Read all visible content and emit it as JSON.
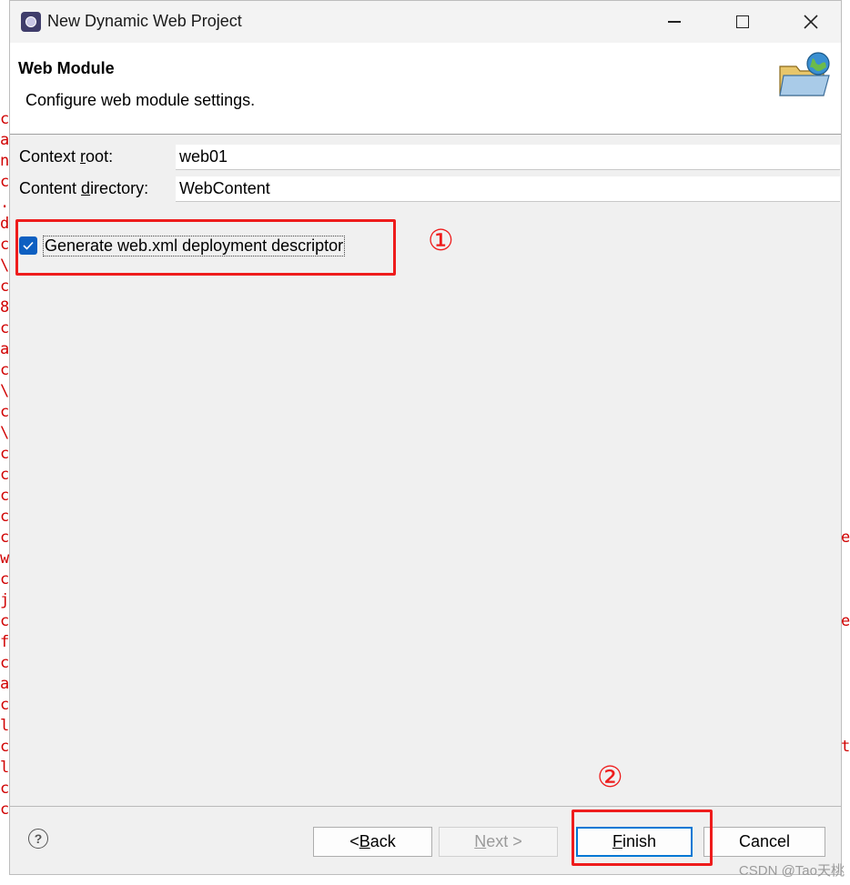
{
  "window": {
    "title": "New Dynamic Web Project"
  },
  "banner": {
    "title": "Web Module",
    "description": "Configure web module settings."
  },
  "form": {
    "context_root": {
      "label_pre": "Context ",
      "label_mnemonic": "r",
      "label_post": "oot:",
      "value": "web01"
    },
    "content_directory": {
      "label_pre": "Content ",
      "label_mnemonic": "d",
      "label_post": "irectory:",
      "value": "WebContent"
    }
  },
  "options": {
    "generate_descriptor": {
      "label": "Generate web.xml deployment descriptor",
      "checked": true
    }
  },
  "annotations": {
    "step1": "①",
    "step2": "②",
    "color": "#ee1c1c"
  },
  "buttons": {
    "back": {
      "pre": "< ",
      "mnemonic": "B",
      "post": "ack"
    },
    "next": {
      "mnemonic": "N",
      "post": "ext >"
    },
    "finish": {
      "mnemonic": "F",
      "post": "inish"
    },
    "cancel": "Cancel"
  },
  "help_symbol": "?",
  "watermark": "CSDN @Tao天桃",
  "background": {
    "left_column": "c\na\nn\nc\n.\nd\nc\n\\\nc\n8\nc\na\nc\n\\\nc\n\\\nc\nc\nc\nc\nc\nw\nc\nj\nc\nf\nc\na\nc\nl\nc\nl\nc\nc",
    "right_column": "\n\n\n\n\n\n\n\n\n\n\n\n\n\n\n\n\n\n\n\ne\n\n\n\ne\n\n\n\n\n\nt"
  }
}
